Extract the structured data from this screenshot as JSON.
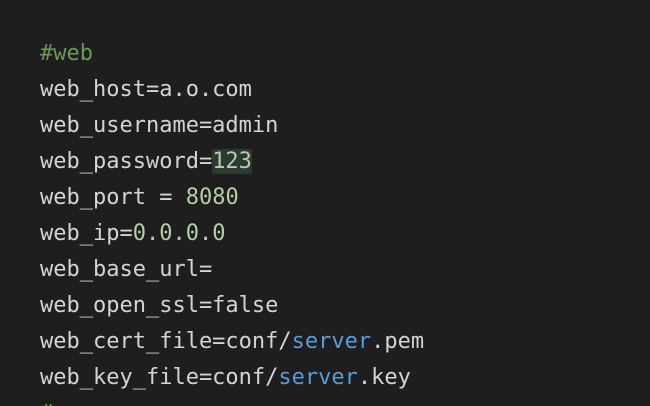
{
  "editor": {
    "lines": [
      {
        "parts": [
          {
            "text": "#web",
            "kind": "comment"
          }
        ]
      },
      {
        "parts": [
          {
            "text": "web_host=a.o.com",
            "kind": "plain"
          }
        ]
      },
      {
        "parts": [
          {
            "text": "web_username=admin",
            "kind": "plain"
          }
        ]
      },
      {
        "parts": [
          {
            "text": "web_password=",
            "kind": "plain"
          },
          {
            "text": "123",
            "kind": "number-highlight"
          }
        ]
      },
      {
        "parts": [
          {
            "text": "web_port = ",
            "kind": "plain"
          },
          {
            "text": "8080",
            "kind": "number"
          }
        ]
      },
      {
        "parts": [
          {
            "text": "web_ip=",
            "kind": "plain"
          },
          {
            "text": "0.0.0.0",
            "kind": "number"
          }
        ]
      },
      {
        "parts": [
          {
            "text": "web_base_url=",
            "kind": "plain"
          }
        ]
      },
      {
        "parts": [
          {
            "text": "web_open_ssl=false",
            "kind": "plain"
          }
        ]
      },
      {
        "parts": [
          {
            "text": "web_cert_file=conf/",
            "kind": "plain"
          },
          {
            "text": "server",
            "kind": "link"
          },
          {
            "text": ".pem",
            "kind": "plain"
          }
        ]
      },
      {
        "parts": [
          {
            "text": "web_key_file=conf/",
            "kind": "plain"
          },
          {
            "text": "server",
            "kind": "link"
          },
          {
            "text": ".key",
            "kind": "plain"
          }
        ]
      }
    ],
    "cutoff_line": "#…"
  },
  "colors": {
    "background": "#1e1e1e",
    "text": "#d4d4d4",
    "comment": "#6a9955",
    "number": "#b5cea8",
    "link": "#569cd6"
  }
}
